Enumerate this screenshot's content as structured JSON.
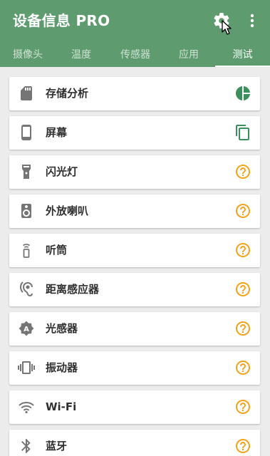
{
  "app": {
    "title": "设备信息 PRO",
    "icons": {
      "settings": "gear-icon",
      "overflow": "more-vert-icon"
    }
  },
  "tabs": [
    {
      "label": "摄像头",
      "active": false
    },
    {
      "label": "温度",
      "active": false
    },
    {
      "label": "传感器",
      "active": false
    },
    {
      "label": "应用",
      "active": false
    },
    {
      "label": "测试",
      "active": true
    }
  ],
  "tests": [
    {
      "label": "存储分析",
      "icon": "sd-card-icon",
      "status_icon": "pie-chart-icon"
    },
    {
      "label": "屏幕",
      "icon": "phone-icon",
      "status_icon": "copy-icon"
    },
    {
      "label": "闪光灯",
      "icon": "flashlight-icon",
      "status_icon": "help-icon"
    },
    {
      "label": "外放喇叭",
      "icon": "speaker-icon",
      "status_icon": "help-icon"
    },
    {
      "label": "听筒",
      "icon": "earpiece-icon",
      "status_icon": "help-icon"
    },
    {
      "label": "距离感应器",
      "icon": "hearing-icon",
      "status_icon": "help-icon"
    },
    {
      "label": "光感器",
      "icon": "light-sensor-icon",
      "status_icon": "help-icon"
    },
    {
      "label": "振动器",
      "icon": "vibration-icon",
      "status_icon": "help-icon"
    },
    {
      "label": "Wi-Fi",
      "icon": "wifi-icon",
      "status_icon": "help-icon"
    },
    {
      "label": "蓝牙",
      "icon": "bluetooth-icon",
      "status_icon": "help-icon"
    }
  ],
  "colors": {
    "primary": "#5e9b6e",
    "accent_green": "#3a8f5c",
    "help_orange": "#f2a31c",
    "icon_gray": "#757575"
  }
}
